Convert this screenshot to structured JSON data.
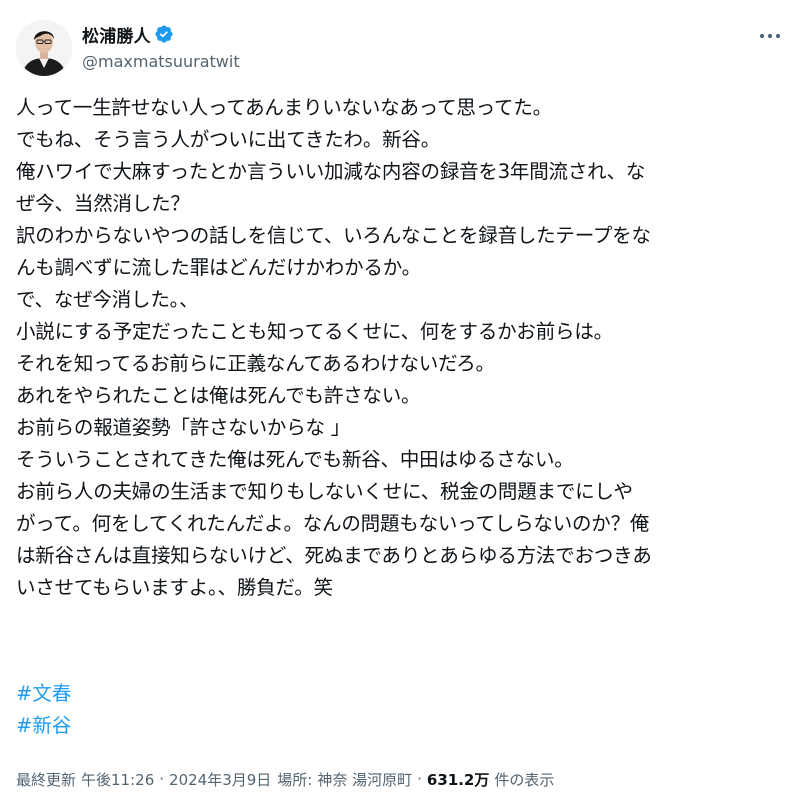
{
  "author": {
    "display_name": "松浦勝人",
    "handle": "@maxmatsuuratwit",
    "verified": true
  },
  "colors": {
    "accent": "#1d9bf0",
    "text": "#0f1419",
    "secondary_text": "#536471",
    "background": "#ffffff"
  },
  "icons": {
    "verified": "verified-badge-icon",
    "more": "more-options-icon"
  },
  "post": {
    "lines": [
      "人って一生許せない人ってあんまりいないなあって思ってた。",
      "でもね、そう言う人がついに出てきたわ。新谷。",
      "俺ハワイで大麻すったとか言ういい加減な内容の録音を3年間流され、な",
      "ぜ今、当然消した？",
      "訳のわからないやつの話しを信じて、いろんなことを録音したテープをな",
      "んも調べずに流した罪はどんだけかわかるか。",
      "で、なぜ今消した。、",
      "小説にする予定だったことも知ってるくせに、何をするかお前らは。",
      "それを知ってるお前らに正義なんてあるわけないだろ。",
      "あれをやられたことは俺は死んでも許さない。",
      "お前らの報道姿勢「許さないからな 」",
      "そういうことされてきた俺は死んでも新谷、中田はゆるさない。",
      "お前ら人の夫婦の生活まで知りもしないくせに、税金の問題までにしや",
      "がって。何をしてくれたんだよ。なんの問題もないってしらないのか？俺",
      "は新谷さんは直接知らないけど、死ぬまでありとあらゆる方法でおつきあ",
      "いさせてもらいますよ。、勝負だ。笑"
    ],
    "hashtags": [
      "#文春",
      "#新谷"
    ]
  },
  "meta": {
    "last_updated_label": "最終更新",
    "time": "午後11:26",
    "date": "2024年3月9日",
    "location_label": "場所:",
    "location": "神奈 湯河原町",
    "views_count": "631.2万",
    "views_label": "件の表示",
    "separator": "·"
  }
}
